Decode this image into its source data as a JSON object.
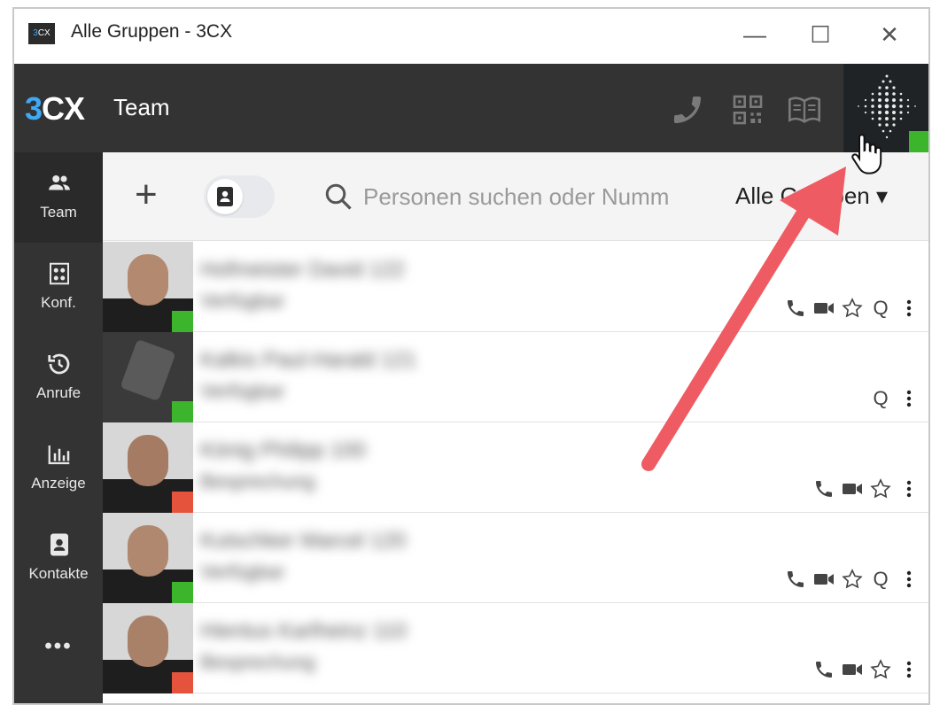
{
  "window": {
    "title": "Alle Gruppen - 3CX",
    "logo_text": "3CX",
    "controls": [
      "—",
      "☐",
      "✕"
    ]
  },
  "header": {
    "brand_prefix": "3",
    "brand_suffix": "CX",
    "title": "Team",
    "icons": [
      "phone-icon",
      "qr-code-icon",
      "phonebook-icon"
    ]
  },
  "sidebar": {
    "items": [
      {
        "label": "Team",
        "icon": "team-icon",
        "active": true
      },
      {
        "label": "Konf.",
        "icon": "conference-icon",
        "active": false
      },
      {
        "label": "Anrufe",
        "icon": "history-icon",
        "active": false
      },
      {
        "label": "Anzeige",
        "icon": "panel-icon",
        "active": false
      },
      {
        "label": "Kontakte",
        "icon": "contacts-icon",
        "active": false
      },
      {
        "label": "•••",
        "icon": "more-icon",
        "active": false
      }
    ]
  },
  "toolbar": {
    "add_label": "+",
    "search_placeholder": "Personen suchen oder Numm",
    "group_select": "Alle Gruppen ▾"
  },
  "contacts": [
    {
      "name": "Hofmeister David 122",
      "status": "Verfügbar",
      "presence": "available",
      "actions": [
        "phone",
        "video",
        "star",
        "queue",
        "more"
      ]
    },
    {
      "name": "Kalkis Paul-Harald 121",
      "status": "Verfügbar",
      "presence": "available",
      "actions": [
        "queue",
        "more"
      ]
    },
    {
      "name": "König Philipp 100",
      "status": "Besprechung",
      "presence": "busy",
      "actions": [
        "phone",
        "video",
        "star",
        "more"
      ]
    },
    {
      "name": "Kutschker Marcel 120",
      "status": "Verfügbar",
      "presence": "available",
      "actions": [
        "phone",
        "video",
        "star",
        "queue",
        "more"
      ]
    },
    {
      "name": "Hientus Karlheinz 110",
      "status": "Besprechung",
      "presence": "busy",
      "actions": [
        "phone",
        "video",
        "star",
        "more"
      ]
    }
  ],
  "colors": {
    "accent_blue": "#3fa9f5",
    "header_bg": "#333333",
    "available": "#3cb52d",
    "busy": "#e5533d",
    "annotation_arrow": "#ef5b62"
  }
}
